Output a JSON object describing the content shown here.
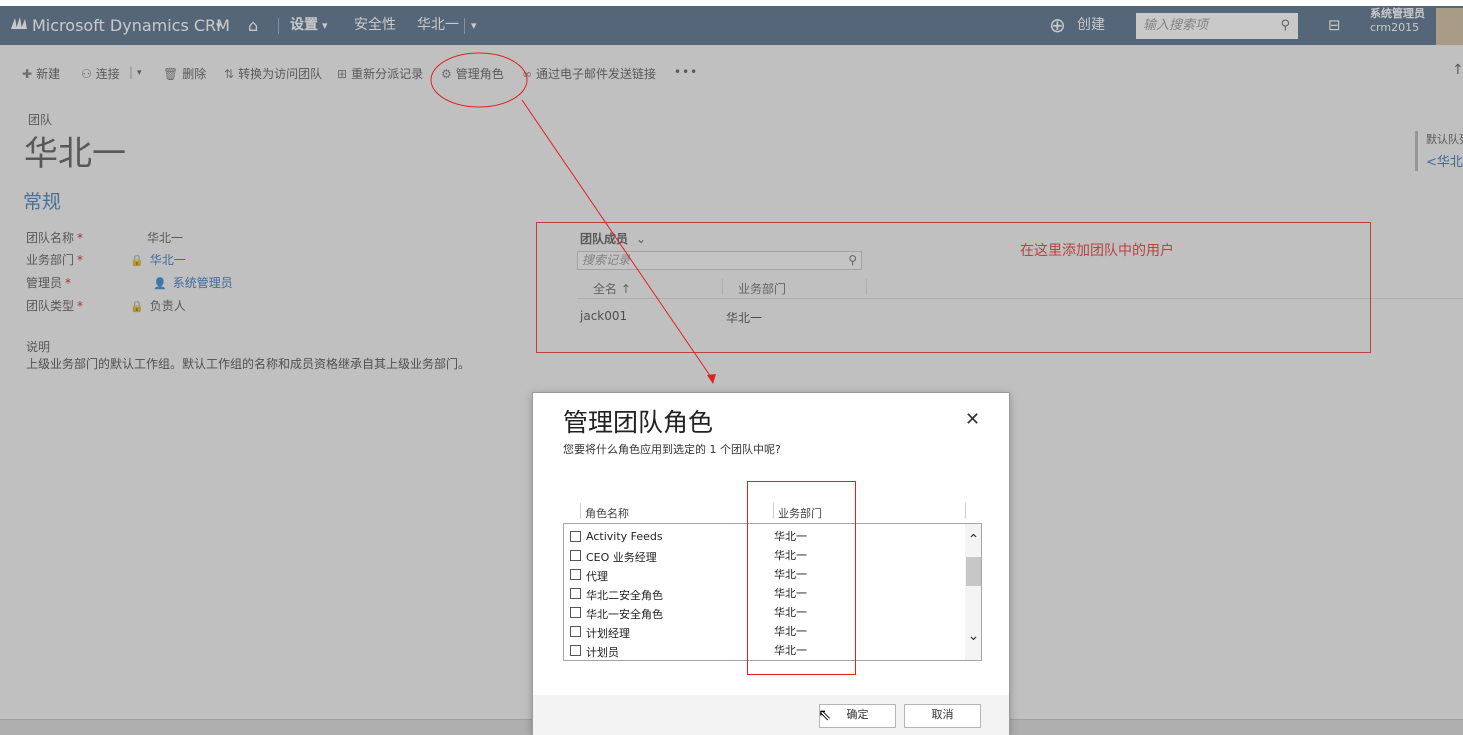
{
  "navbar": {
    "brand": "Microsoft Dynamics CRM",
    "settings": "设置",
    "security": "安全性",
    "record": "华北一",
    "create": "创建",
    "search_placeholder": "输入搜索项",
    "user_name": "系统管理员",
    "org_name": "crm2015"
  },
  "commands": {
    "new": "新建",
    "connect": "连接",
    "delete": "删除",
    "convert": "转换为访问团队",
    "reassign": "重新分派记录",
    "manage_roles": "管理角色",
    "email_link": "通过电子邮件发送链接",
    "more": "•••"
  },
  "header": {
    "entity": "团队",
    "title": "华北一",
    "right_label": "默认队列",
    "right_value": "<华北一"
  },
  "form": {
    "section": "常规",
    "fields": [
      {
        "label": "团队名称",
        "value": "华北一"
      },
      {
        "label": "业务部门",
        "value": "华北一"
      },
      {
        "label": "管理员",
        "value": "系统管理员"
      },
      {
        "label": "团队类型",
        "value": "负责人"
      }
    ],
    "desc_label": "说明",
    "desc_text": "上级业务部门的默认工作组。默认工作组的名称和成员资格继承自其上级业务部门。"
  },
  "members": {
    "title": "团队成员",
    "search_placeholder": "搜索记录",
    "col_name": "全名 ↑",
    "col_bu": "业务部门",
    "rows": [
      {
        "name": "jack001",
        "bu": "华北一"
      }
    ]
  },
  "annotation": {
    "text": "在这里添加团队中的用户",
    "color": "#e0201c"
  },
  "dialog": {
    "title": "管理团队角色",
    "subtitle": "您要将什么角色应用到选定的 1 个团队中呢?",
    "col_role": "角色名称",
    "col_bu": "业务部门",
    "roles": [
      {
        "name": "Activity Feeds",
        "bu": "华北一",
        "checked": false
      },
      {
        "name": "CEO 业务经理",
        "bu": "华北一",
        "checked": false
      },
      {
        "name": "代理",
        "bu": "华北一",
        "checked": false
      },
      {
        "name": "华北二安全角色",
        "bu": "华北一",
        "checked": false
      },
      {
        "name": "华北一安全角色",
        "bu": "华北一",
        "checked": false
      },
      {
        "name": "计划经理",
        "bu": "华北一",
        "checked": false
      },
      {
        "name": "计划员",
        "bu": "华北一",
        "checked": false
      }
    ],
    "ok": "确定",
    "cancel": "取消"
  },
  "colors": {
    "navbar": "#3d5a78",
    "link": "#1f60b5",
    "section": "#2b6ca7"
  }
}
